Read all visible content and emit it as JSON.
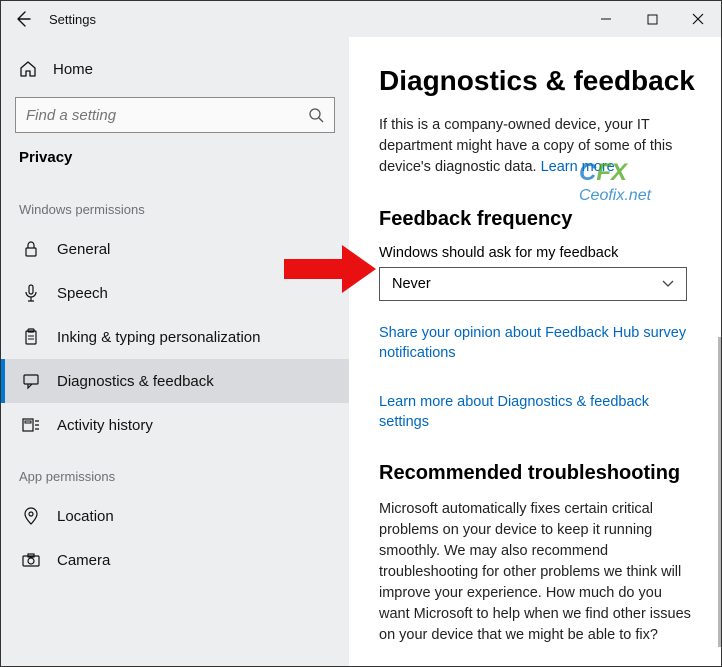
{
  "window": {
    "title": "Settings"
  },
  "sidebar": {
    "home": "Home",
    "search_placeholder": "Find a setting",
    "category": "Privacy",
    "group1_label": "Windows permissions",
    "items1": [
      {
        "label": "General"
      },
      {
        "label": "Speech"
      },
      {
        "label": "Inking & typing personalization"
      },
      {
        "label": "Diagnostics & feedback"
      },
      {
        "label": "Activity history"
      }
    ],
    "group2_label": "App permissions",
    "items2": [
      {
        "label": "Location"
      },
      {
        "label": "Camera"
      }
    ]
  },
  "content": {
    "title": "Diagnostics & feedback",
    "intro_text": "If this is a company-owned device, your IT department might have a copy of some of this device's diagnostic data. ",
    "intro_link": "Learn more",
    "feedback_heading": "Feedback frequency",
    "feedback_label": "Windows should ask for my feedback",
    "dropdown_value": "Never",
    "link1": "Share your opinion about Feedback Hub survey notifications",
    "link2": "Learn more about Diagnostics & feedback settings",
    "troubleshoot_heading": "Recommended troubleshooting",
    "troubleshoot_text": "Microsoft automatically fixes certain critical problems on your device to keep it running smoothly. We may also recommend troubleshooting for other problems we think will improve your experience. How much do you want Microsoft to help when we find other issues on your device that we might be able to fix?"
  },
  "watermark": {
    "line1a": "C",
    "line1b": "FX",
    "line2": "Ceofix.net"
  }
}
